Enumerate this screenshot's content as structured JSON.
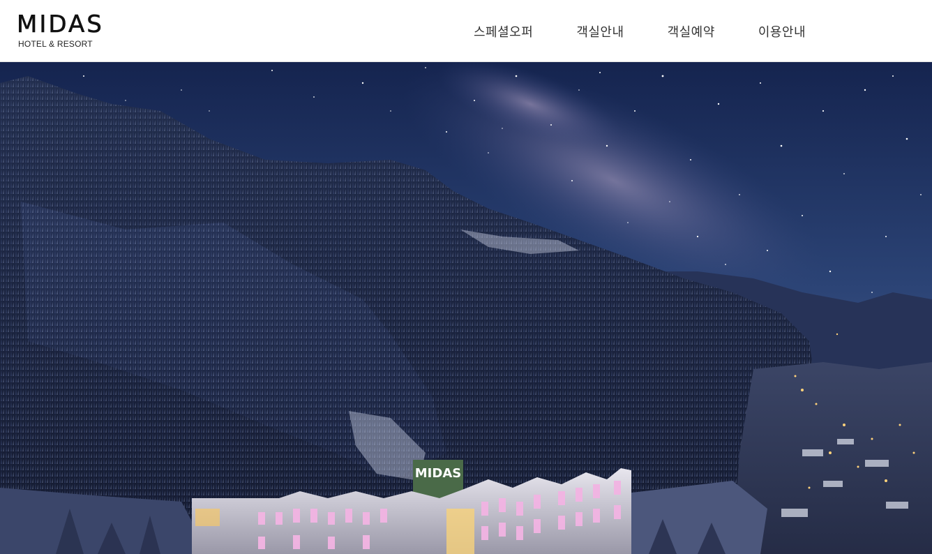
{
  "brand": {
    "name": "MIDAS",
    "tagline": "HOTEL & RESORT",
    "building_sign": "MIDAS"
  },
  "nav": {
    "items": [
      {
        "label": "스페셜오퍼"
      },
      {
        "label": "객실안내"
      },
      {
        "label": "객실예약"
      },
      {
        "label": "이용안내"
      }
    ]
  },
  "colors": {
    "header_bg": "#ffffff",
    "nav_text": "#333333",
    "sky_top": "#1a2a55",
    "sky_bottom": "#3c5a90",
    "mountain": "#1c2744",
    "hotel_light": "#f0b0e0"
  }
}
